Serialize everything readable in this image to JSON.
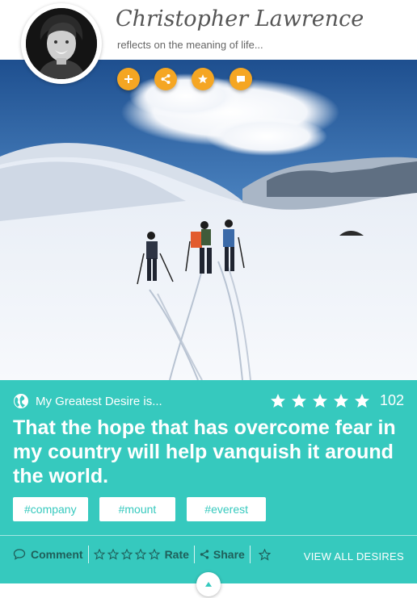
{
  "profile": {
    "name": "Christopher Lawrence",
    "tagline": "reflects on the meaning of life..."
  },
  "actions": [
    {
      "name": "add",
      "icon": "plus-icon"
    },
    {
      "name": "share",
      "icon": "share-icon"
    },
    {
      "name": "favorite",
      "icon": "star-icon"
    },
    {
      "name": "chat",
      "icon": "chat-bubble-icon"
    }
  ],
  "card": {
    "label": "My Greatest Desire is...",
    "rating": {
      "stars": 5,
      "count": "102"
    },
    "quote": "That the hope that has overcome fear in my country will help vanquish it around the world.",
    "tags": [
      "#company",
      "#mount",
      "#everest"
    ],
    "toolbar": {
      "comment": "Comment",
      "rate": "Rate",
      "share": "Share"
    },
    "view_all": "VIEW ALL DESIRES"
  },
  "colors": {
    "accent": "#36c9be",
    "action": "#f5a623",
    "toolbar_text": "#1f5f5a"
  }
}
